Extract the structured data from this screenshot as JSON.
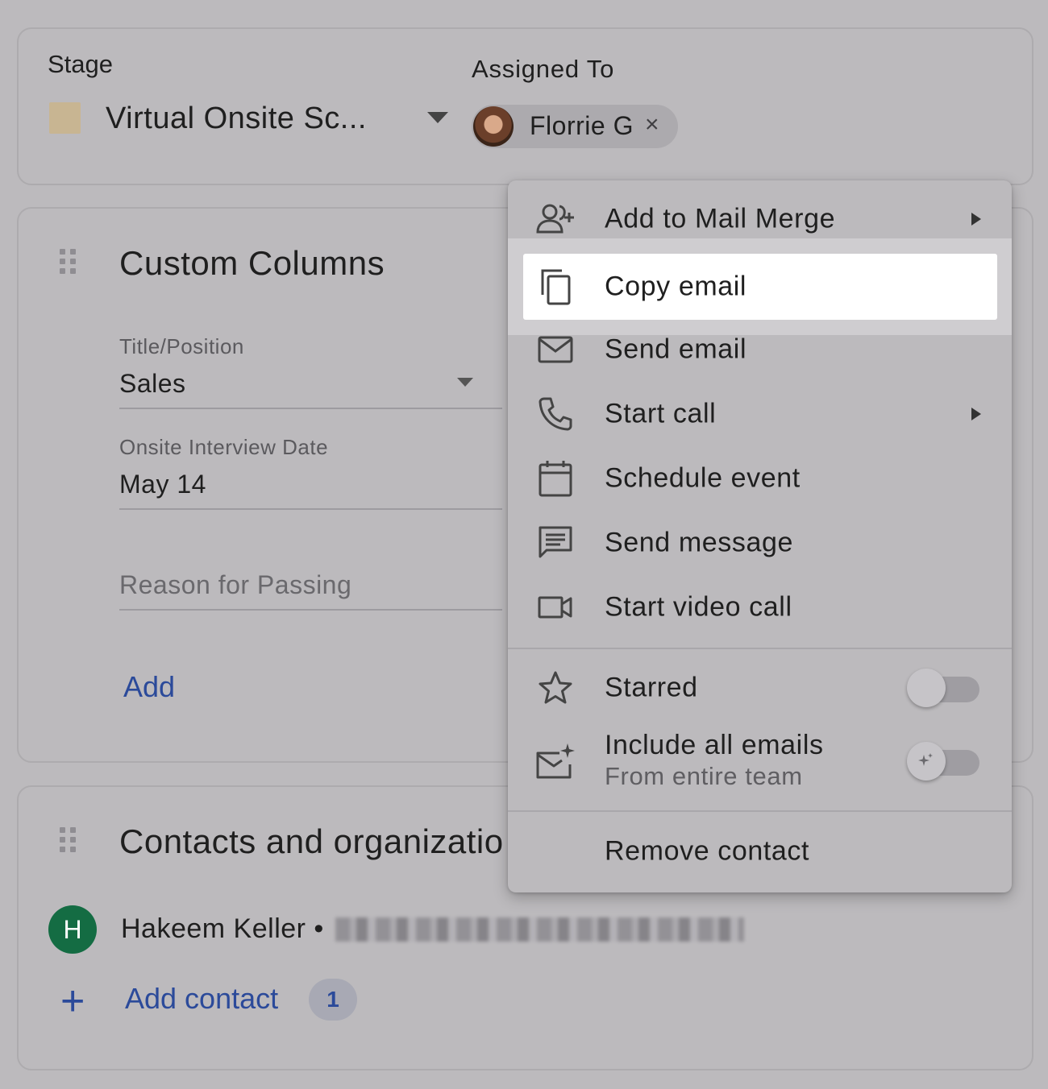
{
  "stage": {
    "label": "Stage",
    "value": "Virtual Onsite Sc...",
    "swatch_color": "#c8b592"
  },
  "assigned": {
    "label": "Assigned To",
    "name": "Florrie G",
    "remove_glyph": "×"
  },
  "custom_columns": {
    "title": "Custom Columns",
    "fields": [
      {
        "label": "Title/Position",
        "value": "Sales"
      },
      {
        "label": "Onsite Interview Date",
        "value": "May 14"
      },
      {
        "placeholder": "Reason for Passing"
      }
    ],
    "add_label": "Add"
  },
  "contacts": {
    "title": "Contacts and organizatio",
    "items": [
      {
        "initial": "H",
        "name": "Hakeem Keller •"
      }
    ],
    "add_label": "Add contact",
    "count": "1",
    "accent_color": "#2b4a9a",
    "avatar_color": "#146c43"
  },
  "menu": {
    "items": [
      {
        "label": "Add to Mail Merge",
        "icon": "add-person-icon",
        "submenu": true
      },
      {
        "label": "Copy email",
        "icon": "copy-icon",
        "highlighted": true
      },
      {
        "label": "Send email",
        "icon": "mail-icon"
      },
      {
        "label": "Start call",
        "icon": "phone-icon",
        "submenu": true
      },
      {
        "label": "Schedule event",
        "icon": "calendar-icon"
      },
      {
        "label": "Send message",
        "icon": "message-icon"
      },
      {
        "label": "Start video call",
        "icon": "video-icon"
      }
    ],
    "starred": {
      "label": "Starred",
      "icon": "star-icon",
      "on": false
    },
    "include_all": {
      "label": "Include all emails",
      "sublabel": "From entire team",
      "icon": "mail-sparkle-icon",
      "on": false
    },
    "remove": {
      "label": "Remove contact"
    }
  }
}
